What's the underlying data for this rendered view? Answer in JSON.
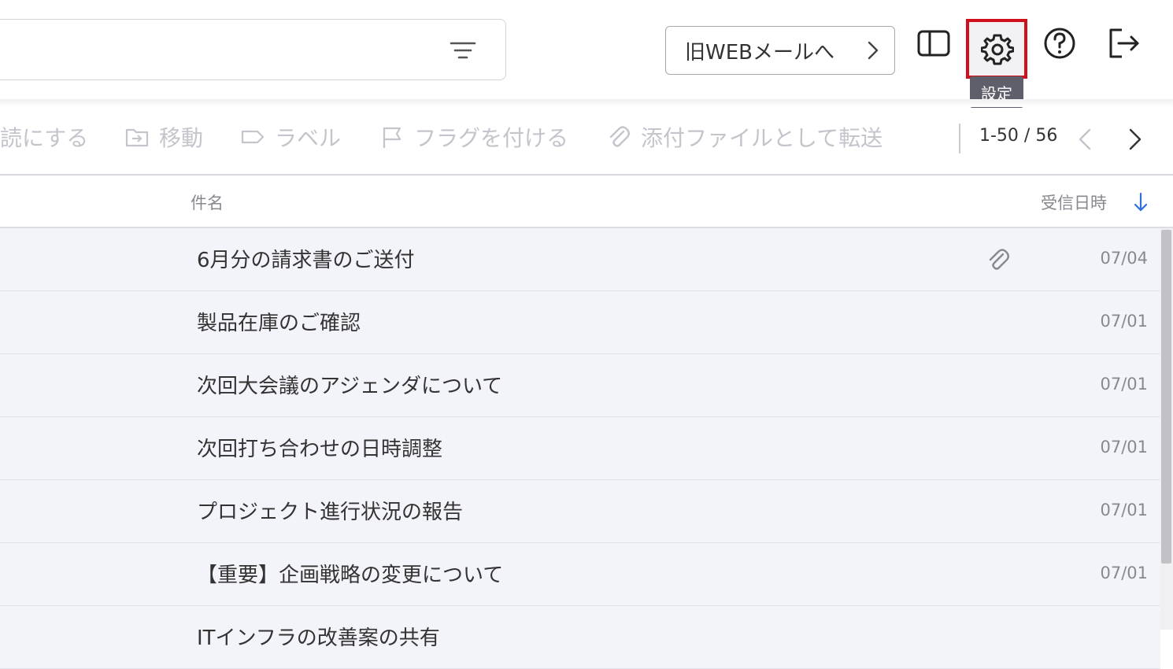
{
  "header": {
    "old_mail_label": "旧WEBメールへ",
    "settings_tooltip": "設定"
  },
  "toolbar": {
    "mark_read_label": "読にする",
    "move_label": "移動",
    "label_label": "ラベル",
    "flag_label": "フラグを付ける",
    "forward_attach_label": "添付ファイルとして転送",
    "pager_text": "1-50 / 56"
  },
  "columns": {
    "subject": "件名",
    "date": "受信日時"
  },
  "emails": [
    {
      "subject": "6月分の請求書のご送付",
      "date": "07/04",
      "attachment": true
    },
    {
      "subject": "製品在庫のご確認",
      "date": "07/01",
      "attachment": false
    },
    {
      "subject": "次回大会議のアジェンダについて",
      "date": "07/01",
      "attachment": false
    },
    {
      "subject": "次回打ち合わせの日時調整",
      "date": "07/01",
      "attachment": false
    },
    {
      "subject": "プロジェクト進行状況の報告",
      "date": "07/01",
      "attachment": false
    },
    {
      "subject": "【重要】企画戦略の変更について",
      "date": "07/01",
      "attachment": false
    },
    {
      "subject": "ITインフラの改善案の共有",
      "date": "",
      "attachment": false
    }
  ],
  "colors": {
    "accent": "#2f6fe0",
    "highlight_border": "#d0111b",
    "row_bg": "#f3f3fa"
  }
}
